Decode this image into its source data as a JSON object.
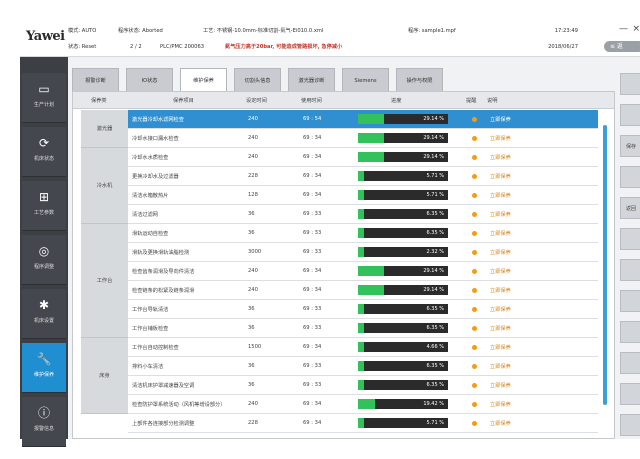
{
  "header": {
    "logo": "Yawei",
    "line1": [
      "模式: AUTO",
      "程序状态: Aborted",
      "工艺: 不锈钢-10.0mm-标准切割-氮气-Ei010.0.xml",
      "程序: sample1.mpf"
    ],
    "line2": [
      "状态: Reset",
      "2 / 2",
      "PLC/PMC 200063",
      "氮气压力高于20bar, 可能造成管路损坏, 急停减小"
    ],
    "time": "17:23:49",
    "date": "2018/06/27",
    "minimize": "—",
    "close": "×",
    "back_label": "≤ 返"
  },
  "sidebar": {
    "items": [
      {
        "icon": "▭",
        "icon_name": "monitor-icon",
        "label": "生产计划"
      },
      {
        "icon": "⟳",
        "icon_name": "refresh-icon",
        "label": "机床状态"
      },
      {
        "icon": "⊞",
        "icon_name": "process-icon",
        "label": "工艺参数"
      },
      {
        "icon": "◎",
        "icon_name": "target-icon",
        "label": "程序调整"
      },
      {
        "icon": "✱",
        "icon_name": "gear-icon",
        "label": "机床设置"
      },
      {
        "icon": "🔧",
        "icon_name": "wrench-icon",
        "label": "维护保养"
      },
      {
        "icon": "ⓘ",
        "icon_name": "info-icon",
        "label": "报警信息"
      }
    ]
  },
  "tabs": [
    "报警诊断",
    "IO状态",
    "维护保养",
    "切割头信息",
    "激光器诊断",
    "Siemens",
    "操作与权限"
  ],
  "table": {
    "headers": [
      "保养类",
      "保养项目",
      "设定时间",
      "使用时间",
      "进度",
      "提醒",
      "说明"
    ],
    "groups": [
      {
        "label": "激光器",
        "rows": 2
      },
      {
        "label": "冷水机",
        "rows": 4
      },
      {
        "label": "工作台",
        "rows": 6
      },
      {
        "label": "床身",
        "rows": 4
      }
    ],
    "rows": [
      {
        "name": "激光器冷却水滤网检查",
        "set": "240",
        "used": "69 : 54",
        "progress": 29.14,
        "label": "29.14 %",
        "status": "立即保养"
      },
      {
        "name": "冷却水接口漏水检查",
        "set": "240",
        "used": "69 : 34",
        "progress": 29.14,
        "label": "29.14 %",
        "status": "立即保养"
      },
      {
        "name": "冷却水水质检查",
        "set": "240",
        "used": "69 : 34",
        "progress": 29.14,
        "label": "29.14 %",
        "status": "立即保养"
      },
      {
        "name": "更换冷却水及过滤器",
        "set": "228",
        "used": "69 : 34",
        "progress": 5.71,
        "label": "5.71 %",
        "status": "立即保养"
      },
      {
        "name": "清洁水箱散热片",
        "set": "128",
        "used": "69 : 34",
        "progress": 5.71,
        "label": "5.71 %",
        "status": "立即保养"
      },
      {
        "name": "清洁过滤网",
        "set": "36",
        "used": "69 : 33",
        "progress": 6.35,
        "label": "6.35 %",
        "status": "立即保养"
      },
      {
        "name": "滑轨运动自检查",
        "set": "36",
        "used": "69 : 33",
        "progress": 6.35,
        "label": "6.35 %",
        "status": "立即保养"
      },
      {
        "name": "滑轨及更换滑轨油脂检测",
        "set": "3000",
        "used": "69 : 33",
        "progress": 2.32,
        "label": "2.32 %",
        "status": "立即保养"
      },
      {
        "name": "检查齿条润滑及导向件清洁",
        "set": "240",
        "used": "69 : 34",
        "progress": 29.14,
        "label": "29.14 %",
        "status": "立即保养"
      },
      {
        "name": "检查链条的松紧及链条润滑",
        "set": "240",
        "used": "69 : 34",
        "progress": 29.14,
        "label": "29.14 %",
        "status": "立即保养"
      },
      {
        "name": "工作台导轨清洁",
        "set": "36",
        "used": "69 : 33",
        "progress": 6.35,
        "label": "6.35 %",
        "status": "立即保养"
      },
      {
        "name": "工作台铺板检查",
        "set": "36",
        "used": "69 : 33",
        "progress": 6.35,
        "label": "6.35 %",
        "status": "立即保养"
      },
      {
        "name": "工作台自动控制检查",
        "set": "1500",
        "used": "69 : 34",
        "progress": 4.66,
        "label": "4.66 %",
        "status": "立即保养"
      },
      {
        "name": "排料小车清洁",
        "set": "36",
        "used": "69 : 33",
        "progress": 6.35,
        "label": "6.35 %",
        "status": "立即保养"
      },
      {
        "name": "清洁机床护罩减速器及空调",
        "set": "36",
        "used": "69 : 33",
        "progress": 6.35,
        "label": "6.35 %",
        "status": "立即保养"
      },
      {
        "name": "检查防护罩系统活动（风机等增设部分）",
        "set": "240",
        "used": "69 : 34",
        "progress": 19.42,
        "label": "19.42 %",
        "status": "立即保养"
      },
      {
        "name": "上部件各连接部分检测调整",
        "set": "228",
        "used": "69 : 34",
        "progress": 5.71,
        "label": "5.71 %",
        "status": "立即保养"
      }
    ]
  },
  "right_buttons": [
    "",
    "",
    "保存",
    "",
    "返回",
    "",
    "",
    "",
    "",
    "",
    "",
    ""
  ],
  "colors": {
    "accent": "#1f8fd1",
    "progress": "#33c15c",
    "warning": "#f39c12"
  }
}
